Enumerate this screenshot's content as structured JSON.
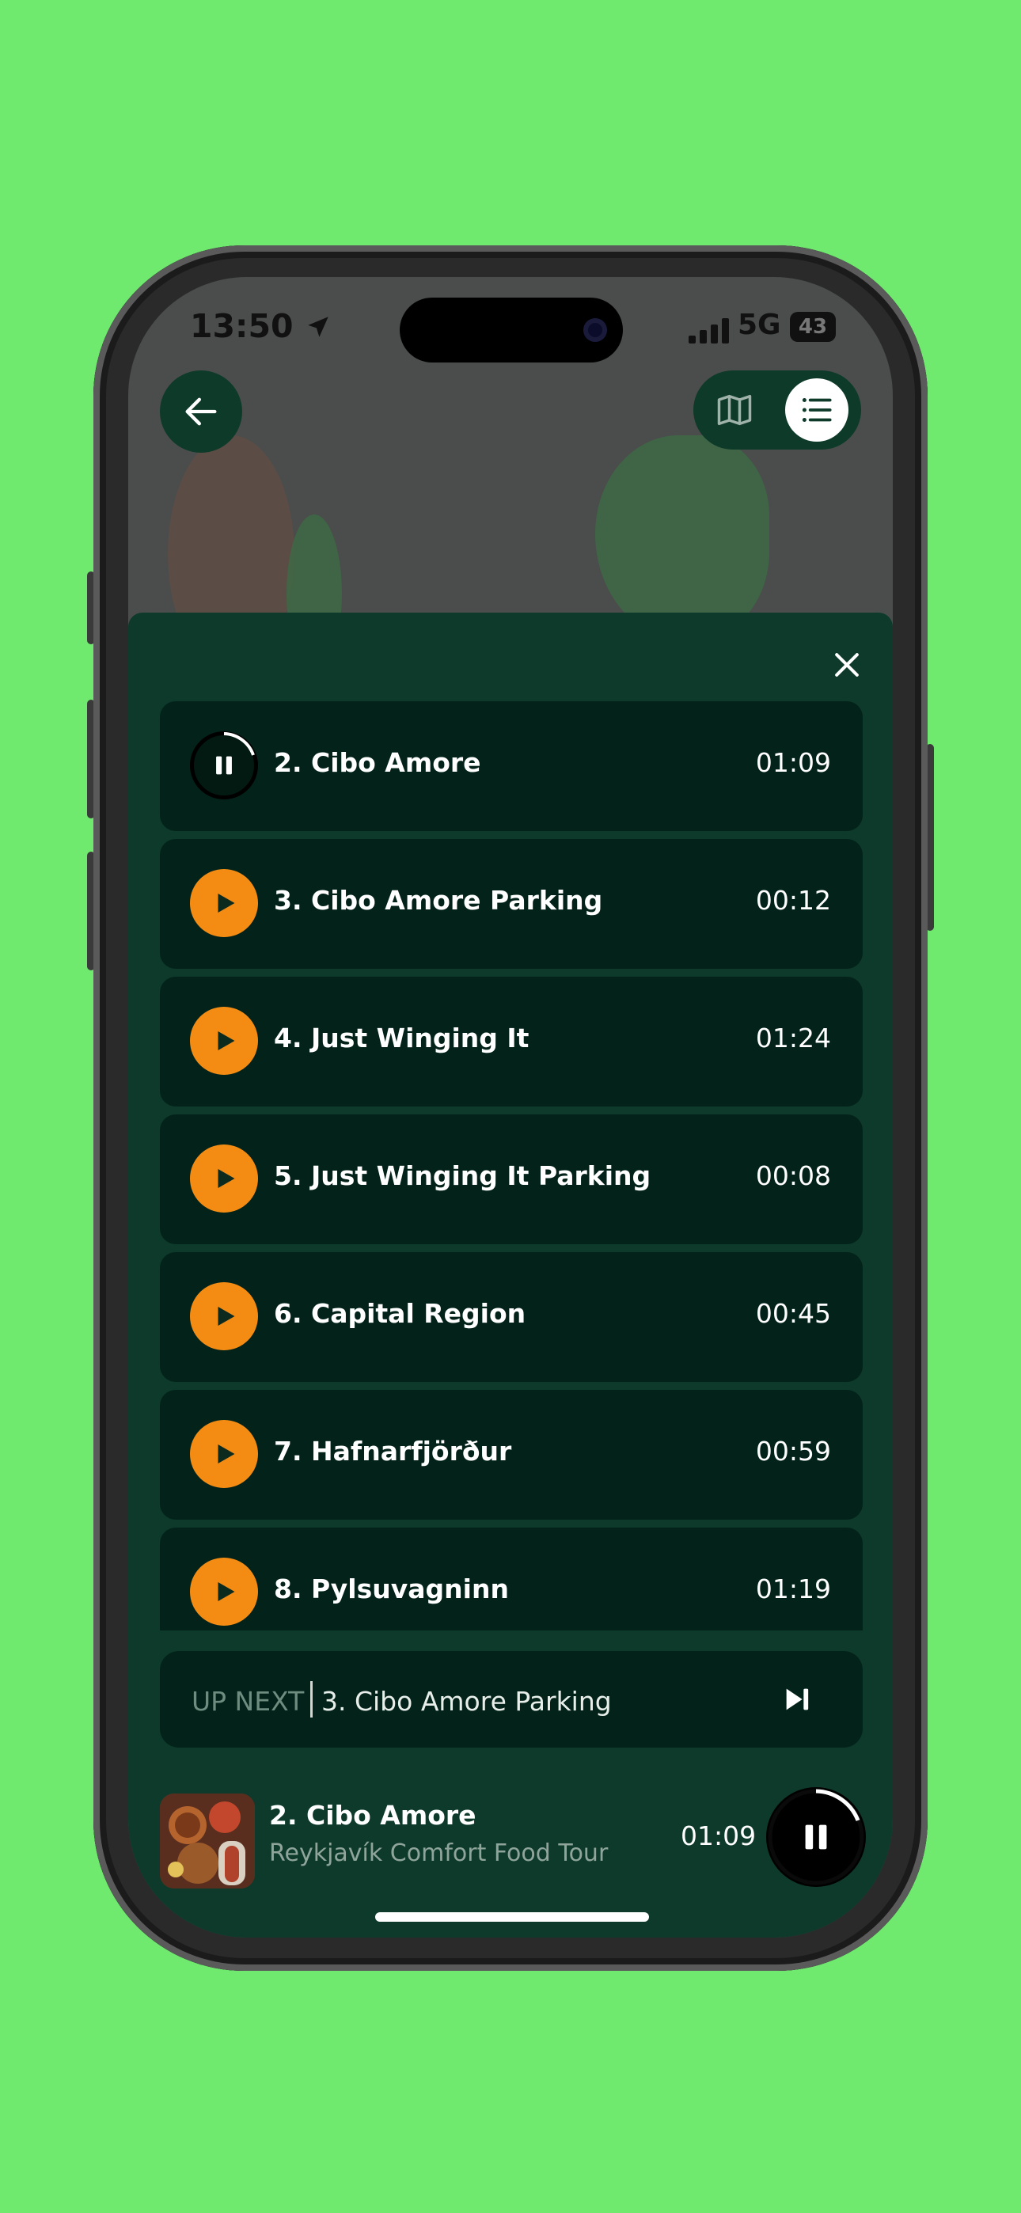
{
  "status_bar": {
    "time": "13:50",
    "network": "5G",
    "battery": "43"
  },
  "header": {
    "back_icon": "arrow-left-icon",
    "map_icon": "map-icon",
    "list_icon": "list-icon"
  },
  "sheet": {
    "close_icon": "close-icon",
    "tracks": [
      {
        "title": "2. Cibo Amore",
        "duration": "01:09",
        "state": "playing"
      },
      {
        "title": "3. Cibo Amore Parking",
        "duration": "00:12",
        "state": "idle"
      },
      {
        "title": "4. Just Winging It",
        "duration": "01:24",
        "state": "idle"
      },
      {
        "title": "5. Just Winging It Parking",
        "duration": "00:08",
        "state": "idle"
      },
      {
        "title": "6. Capital Region",
        "duration": "00:45",
        "state": "idle"
      },
      {
        "title": "7. Hafnarfjörður",
        "duration": "00:59",
        "state": "idle"
      },
      {
        "title": "8. Pylsuvagninn",
        "duration": "01:19",
        "state": "idle"
      }
    ],
    "up_next": {
      "label": "UP NEXT",
      "title": "3. Cibo Amore Parking"
    }
  },
  "now_playing": {
    "title": "2. Cibo Amore",
    "subtitle": "Reykjavík Comfort Food Tour",
    "time": "01:09"
  },
  "colors": {
    "accent": "#f48c14",
    "sheet": "#0d3a2b",
    "row": "#03231a",
    "background": "#6fea6f"
  }
}
